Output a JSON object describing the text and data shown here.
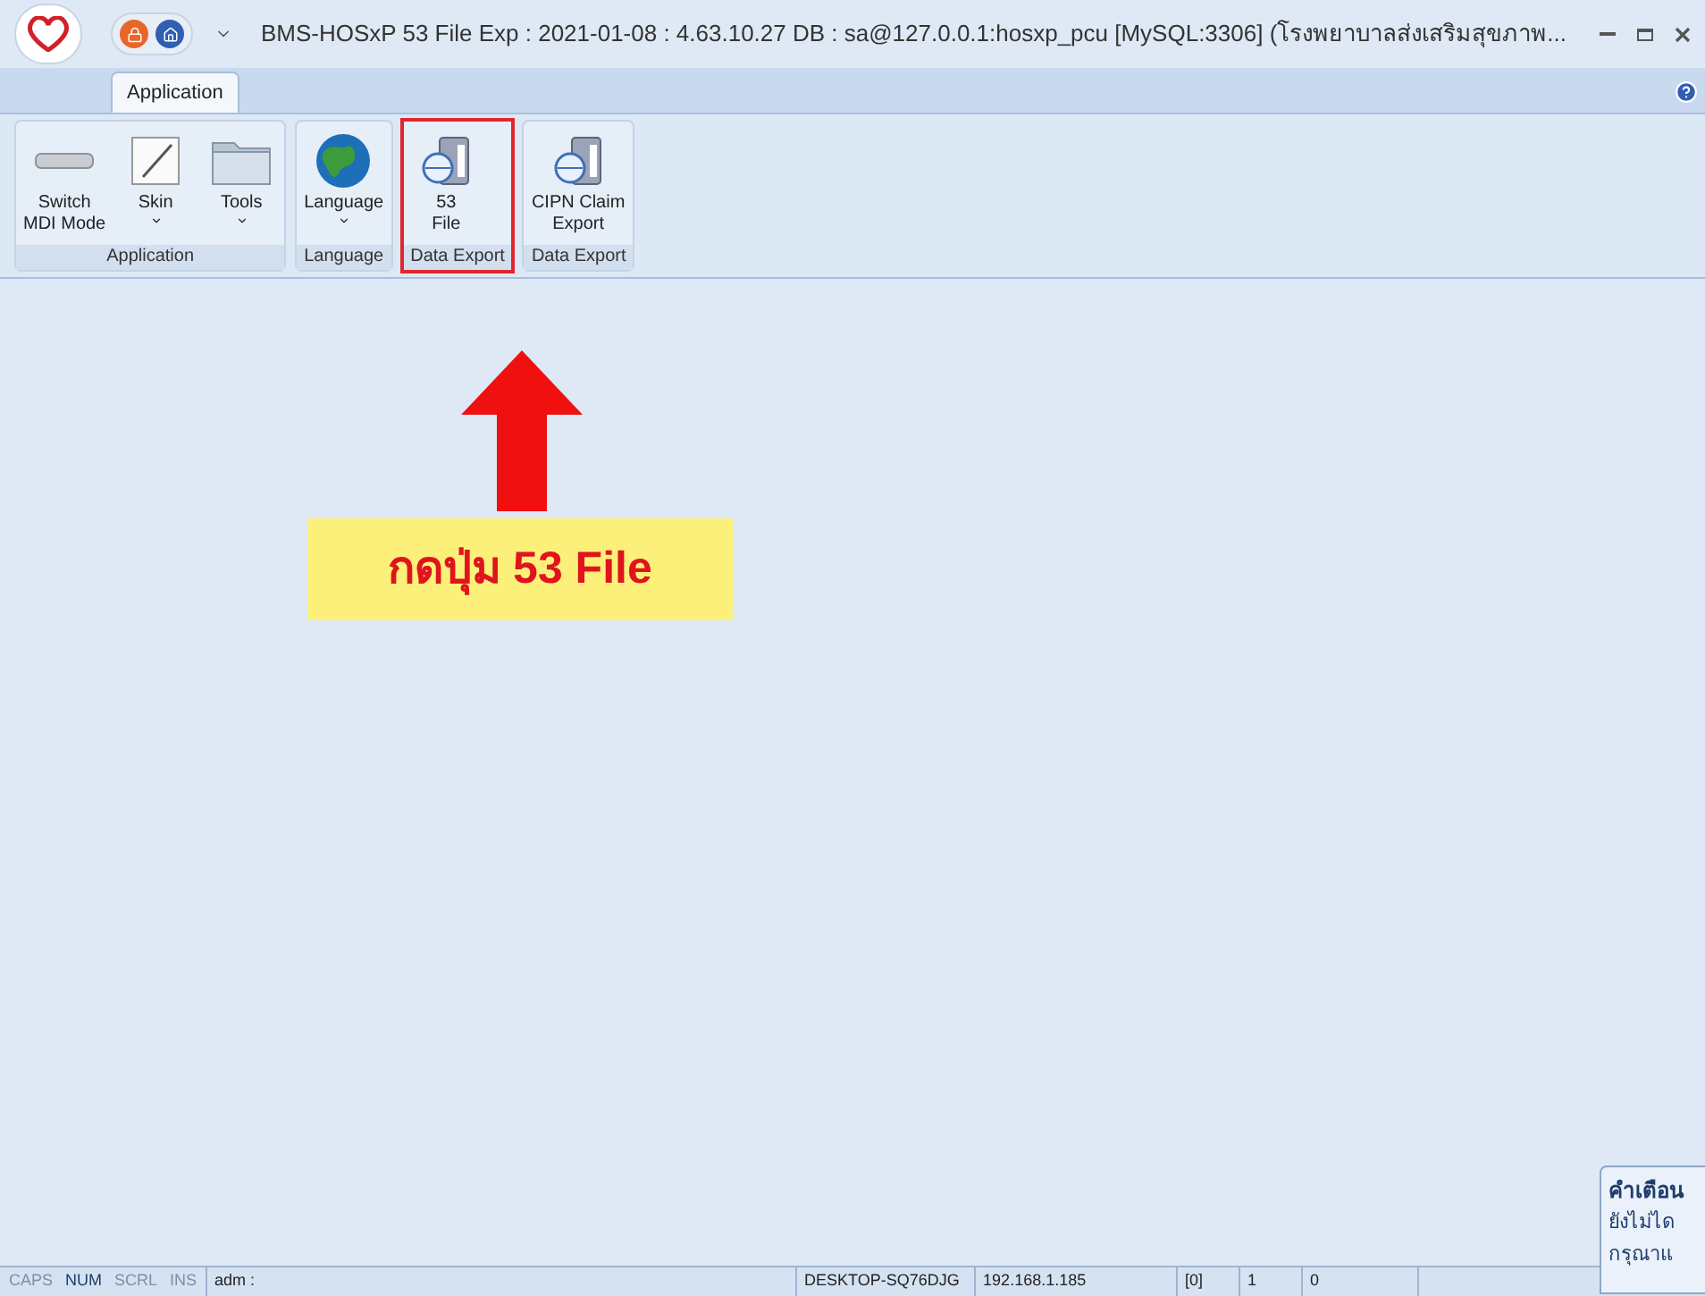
{
  "window": {
    "title": "BMS-HOSxP 53 File Exp : 2021-01-08 : 4.63.10.27 DB : sa@127.0.0.1:hosxp_pcu [MySQL:3306] (โรงพยาบาลส่งเสริมสุขภาพ..."
  },
  "tabs": [
    {
      "label": "Application",
      "selected": true
    }
  ],
  "ribbon_groups": [
    {
      "label": "Application",
      "highlighted": false,
      "buttons": [
        {
          "label": "Switch\nMDI Mode",
          "kind": "bar",
          "dropdown": false
        },
        {
          "label": "Skin",
          "kind": "skin",
          "dropdown": true
        },
        {
          "label": "Tools",
          "kind": "folder",
          "dropdown": true
        }
      ]
    },
    {
      "label": "Language",
      "highlighted": false,
      "buttons": [
        {
          "label": "Language",
          "kind": "globe",
          "dropdown": true
        }
      ]
    },
    {
      "label": "Data Export",
      "highlighted": true,
      "buttons": [
        {
          "label": "53\nFile",
          "kind": "server",
          "dropdown": false
        }
      ]
    },
    {
      "label": "Data Export",
      "highlighted": false,
      "buttons": [
        {
          "label": "CIPN Claim\nExport",
          "kind": "server",
          "dropdown": false
        }
      ]
    }
  ],
  "callout": {
    "text": "กดปุ่ม 53 File"
  },
  "notification": {
    "title": "คำเตือน",
    "lines": [
      "ยังไม่ได",
      "กรุณาแ"
    ]
  },
  "status_bar": {
    "indicators": [
      {
        "label": "CAPS",
        "on": false
      },
      {
        "label": "NUM",
        "on": true
      },
      {
        "label": "SCRL",
        "on": false
      },
      {
        "label": "INS",
        "on": false
      }
    ],
    "user": "adm :",
    "cells": [
      "DESKTOP-SQ76DJG",
      "192.168.1.185",
      "[0]",
      "1",
      "0"
    ]
  }
}
